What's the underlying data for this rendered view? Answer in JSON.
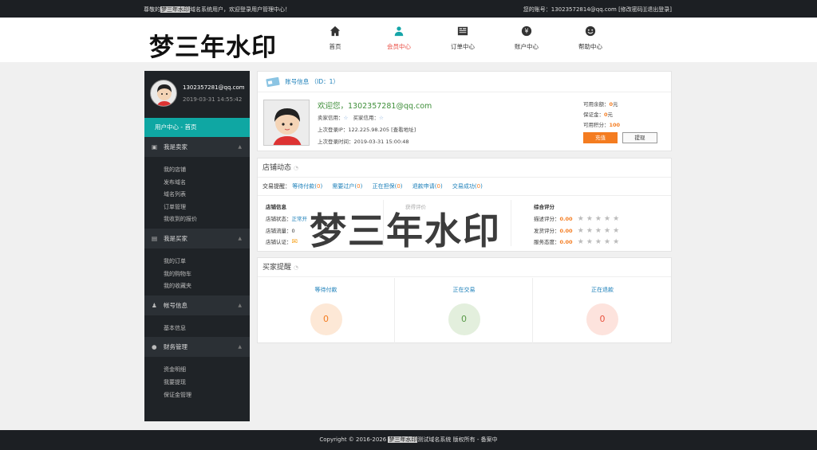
{
  "topbar": {
    "welcome_prefix": "尊敬的",
    "welcome_watermark": "梦三年水印",
    "welcome_suffix": "域名系统用户，欢迎登录用户管理中心！",
    "account_prefix": "您的账号：",
    "account": "13023572814@qq.com",
    "edit_password": "[修改密码]",
    "logout": "[退出登录]"
  },
  "logo": "梦三年水印",
  "nav": [
    {
      "label": "首页",
      "icon": "home-icon"
    },
    {
      "label": "会员中心",
      "icon": "user-icon",
      "active": true
    },
    {
      "label": "订单中心",
      "icon": "orders-icon"
    },
    {
      "label": "账户中心",
      "icon": "account-icon"
    },
    {
      "label": "帮助中心",
      "icon": "help-icon"
    }
  ],
  "sidebar": {
    "email": "1302357281@qq.com",
    "time": "2019-03-31 14:55:42",
    "home": "用户中心 - 首页",
    "groups": [
      {
        "title": "我是卖家",
        "icon": "briefcase-icon",
        "items": [
          "我的店铺",
          "发布域名",
          "域名列表",
          "订单管理",
          "我收到的报价"
        ]
      },
      {
        "title": "我是买家",
        "icon": "list-icon",
        "items": [
          "我的订单",
          "我的购物车",
          "我的收藏夹"
        ]
      },
      {
        "title": "帐号信息",
        "icon": "person-icon",
        "items": [
          "基本信息"
        ]
      },
      {
        "title": "财务管理",
        "icon": "money-icon",
        "items": [
          "资金明细",
          "我要提现",
          "保证金管理"
        ]
      }
    ]
  },
  "account": {
    "title": "账号信息 （ID：1）",
    "welcome": "欢迎您，1302357281@qq.com",
    "seller_credit": "卖家信用：",
    "buyer_credit": "买家信用：",
    "last_ip_label": "上次登录IP：",
    "last_ip": "122.225.98.205",
    "ip_lookup": "[查看地址]",
    "last_time_label": "上次登录时间：",
    "last_time": "2019-03-31 15:00:48",
    "balance_label": "可用余额：",
    "balance": "0",
    "balance_unit": "元",
    "deposit_label": "保证金：",
    "deposit": "0",
    "deposit_unit": "元",
    "points_label": "可用积分：",
    "points": "100",
    "charge_btn": "充值",
    "withdraw_btn": "提现"
  },
  "shop": {
    "title": "店铺动态",
    "tabs_label": "交易提醒：",
    "tabs": [
      {
        "label": "等待付款",
        "count": "0"
      },
      {
        "label": "需要过户",
        "count": "0"
      },
      {
        "label": "正在担保",
        "count": "0"
      },
      {
        "label": "退款申请",
        "count": "0"
      },
      {
        "label": "交易成功",
        "count": "0"
      }
    ],
    "info_title": "店铺信息",
    "status_label": "店铺状态：",
    "status_value": "正常开",
    "traffic_label": "店铺流量：",
    "traffic_value": "0",
    "cert_label": "店铺认证：",
    "reviews_title": "获得评价",
    "rating_title": "综合评分",
    "ratings": [
      {
        "label": "描述评分：",
        "score": "0.00"
      },
      {
        "label": "发货评分：",
        "score": "0.00"
      },
      {
        "label": "服务态度：",
        "score": "0.00"
      }
    ]
  },
  "watermark": "梦三年水印",
  "buyer": {
    "title": "买家提醒",
    "cols": [
      {
        "label": "等待付款",
        "value": "0",
        "bg": "#fde8d6",
        "fg": "#f47c20"
      },
      {
        "label": "正在交易",
        "value": "0",
        "bg": "#e3efdd",
        "fg": "#5a9a4a"
      },
      {
        "label": "正在退款",
        "value": "0",
        "bg": "#fde3dd",
        "fg": "#e9533f"
      }
    ]
  },
  "footer": {
    "prefix": "Copyright © 2016-2026 ",
    "watermark": "梦三年水印",
    "suffix": "测试域名系统 版权所有 - 备案中"
  }
}
